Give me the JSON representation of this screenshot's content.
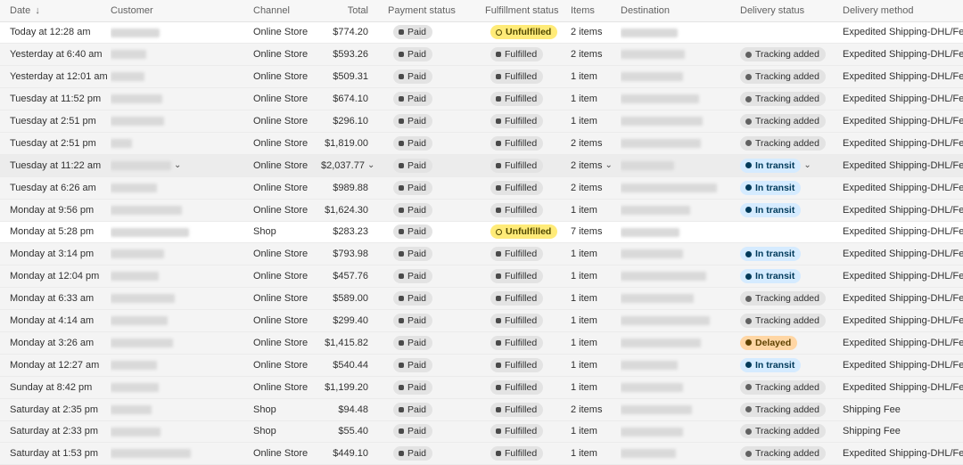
{
  "headers": {
    "date": "Date",
    "date_sort": "↓",
    "customer": "Customer",
    "channel": "Channel",
    "total": "Total",
    "payment_status": "Payment status",
    "fulfillment_status": "Fulfillment status",
    "items": "Items",
    "destination": "Destination",
    "delivery_status": "Delivery status",
    "delivery_method": "Delivery method"
  },
  "colors": {
    "unfulfilled": "#ffeb78",
    "in_transit": "#d5ebff",
    "delayed": "#ffd6a4",
    "neutral_badge": "#e3e3e3"
  },
  "orders": [
    {
      "date": "Today at 12:28 am",
      "channel": "Online Store",
      "total": "$774.20",
      "payment": "Paid",
      "fulfillment": "Unfulfilled",
      "items": "2 items",
      "delivery_status": "",
      "method": "Expedited Shipping-DHL/FedEX/..."
    },
    {
      "date": "Yesterday at 6:40 am",
      "channel": "Online Store",
      "total": "$593.26",
      "payment": "Paid",
      "fulfillment": "Fulfilled",
      "items": "2 items",
      "delivery_status": "Tracking added",
      "method": "Expedited Shipping-DHL/FedEX/..."
    },
    {
      "date": "Yesterday at 12:01 am",
      "channel": "Online Store",
      "total": "$509.31",
      "payment": "Paid",
      "fulfillment": "Fulfilled",
      "items": "1 item",
      "delivery_status": "Tracking added",
      "method": "Expedited Shipping-DHL/FedEX/..."
    },
    {
      "date": "Tuesday at 11:52 pm",
      "channel": "Online Store",
      "total": "$674.10",
      "payment": "Paid",
      "fulfillment": "Fulfilled",
      "items": "1 item",
      "delivery_status": "Tracking added",
      "method": "Expedited Shipping-DHL/FedEX/..."
    },
    {
      "date": "Tuesday at 2:51 pm",
      "channel": "Online Store",
      "total": "$296.10",
      "payment": "Paid",
      "fulfillment": "Fulfilled",
      "items": "1 item",
      "delivery_status": "Tracking added",
      "method": "Expedited Shipping-DHL/FedEX/..."
    },
    {
      "date": "Tuesday at 2:51 pm",
      "channel": "Online Store",
      "total": "$1,819.00",
      "payment": "Paid",
      "fulfillment": "Fulfilled",
      "items": "2 items",
      "delivery_status": "Tracking added",
      "method": "Expedited Shipping-DHL/FedEX/..."
    },
    {
      "date": "Tuesday at 11:22 am",
      "channel": "Online Store",
      "total": "$2,037.77",
      "payment": "Paid",
      "fulfillment": "Fulfilled",
      "items": "2 items",
      "delivery_status": "In transit",
      "method": "Expedited Shipping-DHL/FedEX/..."
    },
    {
      "date": "Tuesday at 6:26 am",
      "channel": "Online Store",
      "total": "$989.88",
      "payment": "Paid",
      "fulfillment": "Fulfilled",
      "items": "2 items",
      "delivery_status": "In transit",
      "method": "Expedited Shipping-DHL/FedEX/..."
    },
    {
      "date": "Monday at 9:56 pm",
      "channel": "Online Store",
      "total": "$1,624.30",
      "payment": "Paid",
      "fulfillment": "Fulfilled",
      "items": "1 item",
      "delivery_status": "In transit",
      "method": "Expedited Shipping-DHL/FedEX/..."
    },
    {
      "date": "Monday at 5:28 pm",
      "channel": "Shop",
      "total": "$283.23",
      "payment": "Paid",
      "fulfillment": "Unfulfilled",
      "items": "7 items",
      "delivery_status": "",
      "method": "Expedited Shipping-DHL/FedEX/..."
    },
    {
      "date": "Monday at 3:14 pm",
      "channel": "Online Store",
      "total": "$793.98",
      "payment": "Paid",
      "fulfillment": "Fulfilled",
      "items": "1 item",
      "delivery_status": "In transit",
      "method": "Expedited Shipping-DHL/FedEX/..."
    },
    {
      "date": "Monday at 12:04 pm",
      "channel": "Online Store",
      "total": "$457.76",
      "payment": "Paid",
      "fulfillment": "Fulfilled",
      "items": "1 item",
      "delivery_status": "In transit",
      "method": "Expedited Shipping-DHL/FedEX/..."
    },
    {
      "date": "Monday at 6:33 am",
      "channel": "Online Store",
      "total": "$589.00",
      "payment": "Paid",
      "fulfillment": "Fulfilled",
      "items": "1 item",
      "delivery_status": "Tracking added",
      "method": "Expedited Shipping-DHL/FedEX/..."
    },
    {
      "date": "Monday at 4:14 am",
      "channel": "Online Store",
      "total": "$299.40",
      "payment": "Paid",
      "fulfillment": "Fulfilled",
      "items": "1 item",
      "delivery_status": "Tracking added",
      "method": "Expedited Shipping-DHL/FedEX/..."
    },
    {
      "date": "Monday at 3:26 am",
      "channel": "Online Store",
      "total": "$1,415.82",
      "payment": "Paid",
      "fulfillment": "Fulfilled",
      "items": "1 item",
      "delivery_status": "Delayed",
      "method": "Expedited Shipping-DHL/FedEX/..."
    },
    {
      "date": "Monday at 12:27 am",
      "channel": "Online Store",
      "total": "$540.44",
      "payment": "Paid",
      "fulfillment": "Fulfilled",
      "items": "1 item",
      "delivery_status": "In transit",
      "method": "Expedited Shipping-DHL/FedEX/..."
    },
    {
      "date": "Sunday at 8:42 pm",
      "channel": "Online Store",
      "total": "$1,199.20",
      "payment": "Paid",
      "fulfillment": "Fulfilled",
      "items": "1 item",
      "delivery_status": "Tracking added",
      "method": "Expedited Shipping-DHL/FedEX/..."
    },
    {
      "date": "Saturday at 2:35 pm",
      "channel": "Shop",
      "total": "$94.48",
      "payment": "Paid",
      "fulfillment": "Fulfilled",
      "items": "2 items",
      "delivery_status": "Tracking added",
      "method": "Shipping Fee"
    },
    {
      "date": "Saturday at 2:33 pm",
      "channel": "Shop",
      "total": "$55.40",
      "payment": "Paid",
      "fulfillment": "Fulfilled",
      "items": "1 item",
      "delivery_status": "Tracking added",
      "method": "Shipping Fee"
    },
    {
      "date": "Saturday at 1:53 pm",
      "channel": "Online Store",
      "total": "$449.10",
      "payment": "Paid",
      "fulfillment": "Fulfilled",
      "items": "1 item",
      "delivery_status": "Tracking added",
      "method": "Expedited Shipping-DHL/FedEX/..."
    }
  ]
}
